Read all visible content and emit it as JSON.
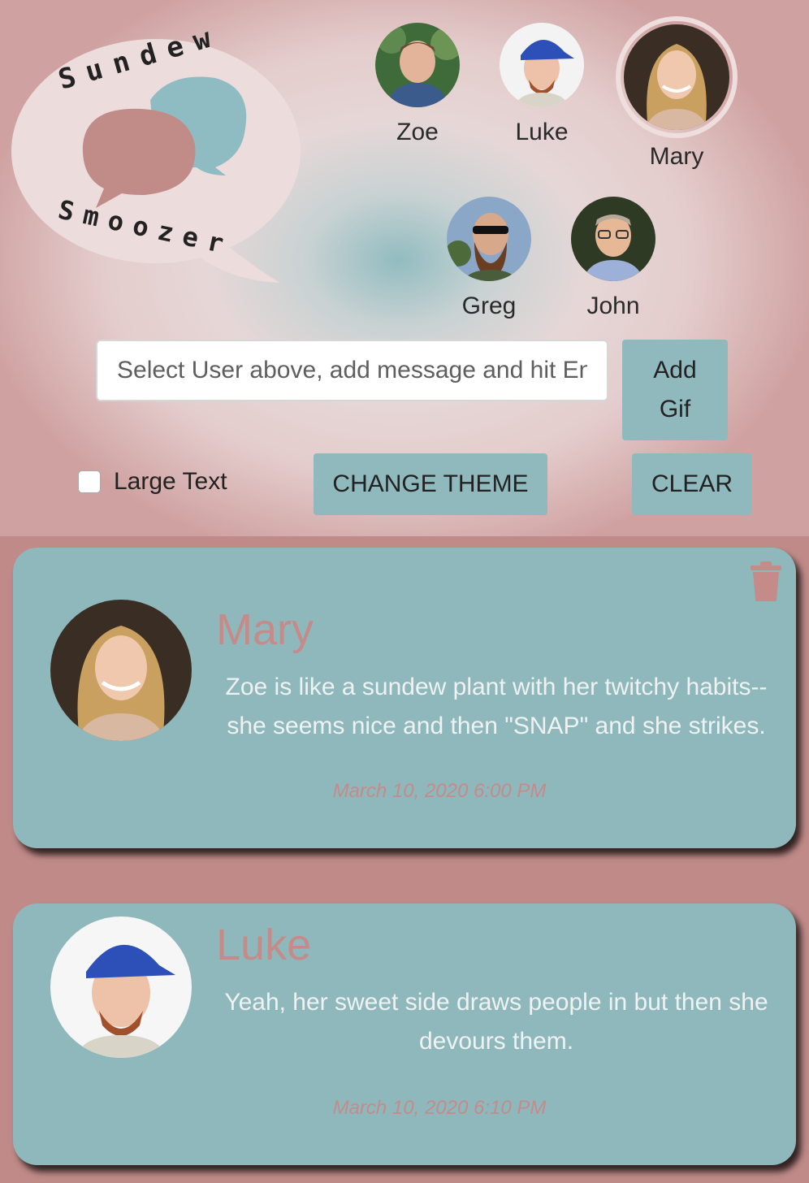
{
  "logo": {
    "top_text": "Sundew",
    "bottom_text": "Smoozer"
  },
  "users": [
    {
      "name": "Zoe"
    },
    {
      "name": "Luke"
    },
    {
      "name": "Mary",
      "selected": true
    },
    {
      "name": "Greg"
    },
    {
      "name": "John"
    }
  ],
  "composer": {
    "placeholder": "Select User above, add message and hit Enter",
    "add_gif_label_line1": "Add",
    "add_gif_label_line2": "Gif",
    "large_text_label": "Large Text",
    "change_theme_label": "CHANGE THEME",
    "clear_label": "CLEAR"
  },
  "messages": [
    {
      "author": "Mary",
      "text": "Zoe is like a sundew plant with her twitchy habits--she seems nice and then \"SNAP\" and she strikes.",
      "time": "March 10, 2020 6:00 PM"
    },
    {
      "author": "Luke",
      "text": "Yeah, her sweet side draws people in but then she devours them.",
      "time": "March 10, 2020 6:10 PM"
    }
  ],
  "colors": {
    "accent": "#8fb9bd",
    "author": "#c48b88",
    "page_bg": "#bf8a87"
  },
  "icons": {
    "delete": "trash-icon"
  }
}
